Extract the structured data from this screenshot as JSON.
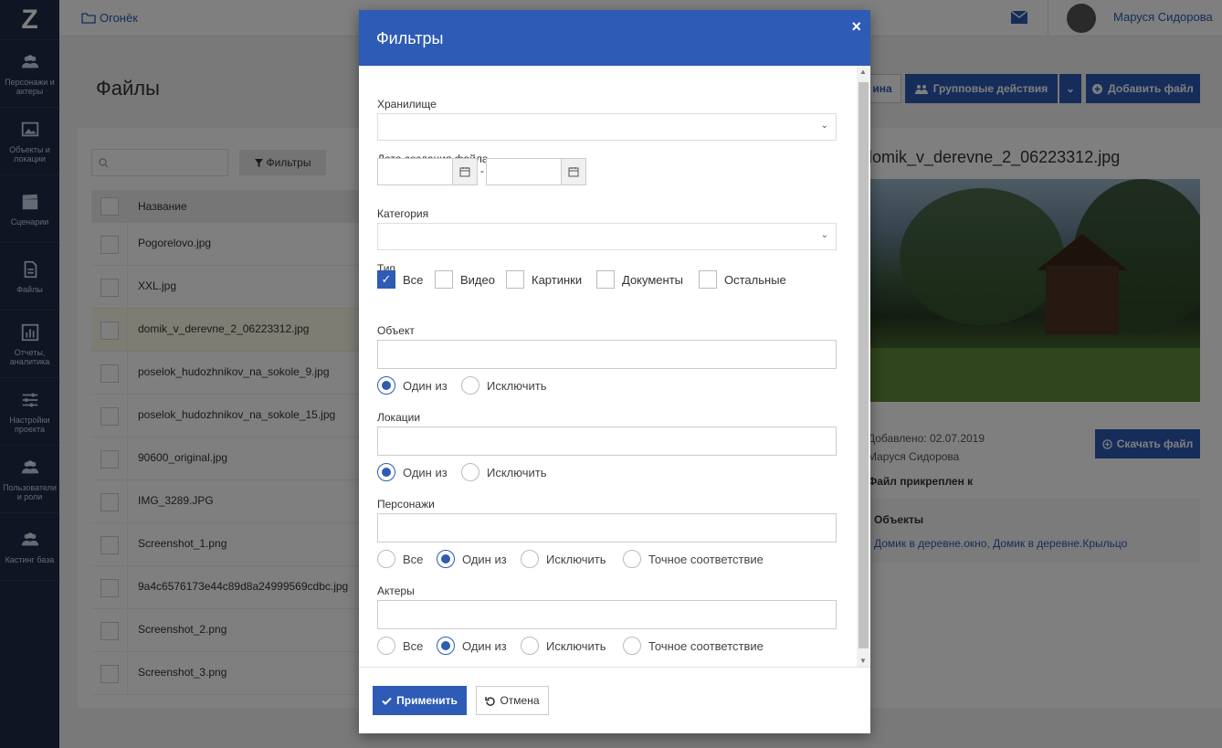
{
  "sidebar": {
    "logo": "Z",
    "items": [
      {
        "label": "Персонажи и актеры"
      },
      {
        "label": "Объекты и локации"
      },
      {
        "label": "Сценарии"
      },
      {
        "label": "Файлы"
      },
      {
        "label": "Отчеты, аналитика"
      },
      {
        "label": "Настройки проекта"
      },
      {
        "label": "Пользователи и роли"
      },
      {
        "label": "Кастинг база"
      }
    ]
  },
  "topbar": {
    "breadcrumb": "Огонёк",
    "user_name": "Маруся Сидорова"
  },
  "page": {
    "title": "Файлы",
    "filters_button": "Фильтры",
    "table_header": "Название",
    "files": [
      "Pogorelovo.jpg",
      "XXL.jpg",
      "domik_v_derevne_2_06223312.jpg",
      "poselok_hudozhnikov_na_sokole_9.jpg",
      "poselok_hudozhnikov_na_sokole_15.jpg",
      "90600_original.jpg",
      "IMG_3289.JPG",
      "Screenshot_1.png",
      "9a4c6576173e44c89d8a24999569cdbc.jpg",
      "Screenshot_2.png",
      "Screenshot_3.png"
    ],
    "cart_button": "ина",
    "group_actions_button": "Групповые действия",
    "add_file_button": "Добавить файл"
  },
  "details": {
    "file_title": "domik_v_derevne_2_06223312.jpg",
    "added": "Добавлено: 02.07.2019",
    "author": "Маруся Сидорова",
    "attached_heading": "Файл прикреплен к",
    "objects_heading": "Объекты",
    "objects_list": "Домик в деревне.окно, Домик в деревне.Крыльцо",
    "download_button": "Скачать файл"
  },
  "modal": {
    "title": "Фильтры",
    "close": "×",
    "storage_label": "Хранилище",
    "date_label": "Дата создания файла",
    "date_sep": "-",
    "category_label": "Категория",
    "type_label": "Тип",
    "type_options": [
      "Все",
      "Видео",
      "Картинки",
      "Документы",
      "Остальные"
    ],
    "object_label": "Объект",
    "location_label": "Локации",
    "characters_label": "Персонажи",
    "actors_label": "Актеры",
    "radio_one_of": "Один из",
    "radio_exclude": "Исключить",
    "radio_all": "Все",
    "radio_exact": "Точное соответствие",
    "apply_button": "Применить",
    "cancel_button": "Отмена"
  },
  "colors": {
    "primary": "#2d5bb5",
    "sidebar": "#1f2a44"
  }
}
